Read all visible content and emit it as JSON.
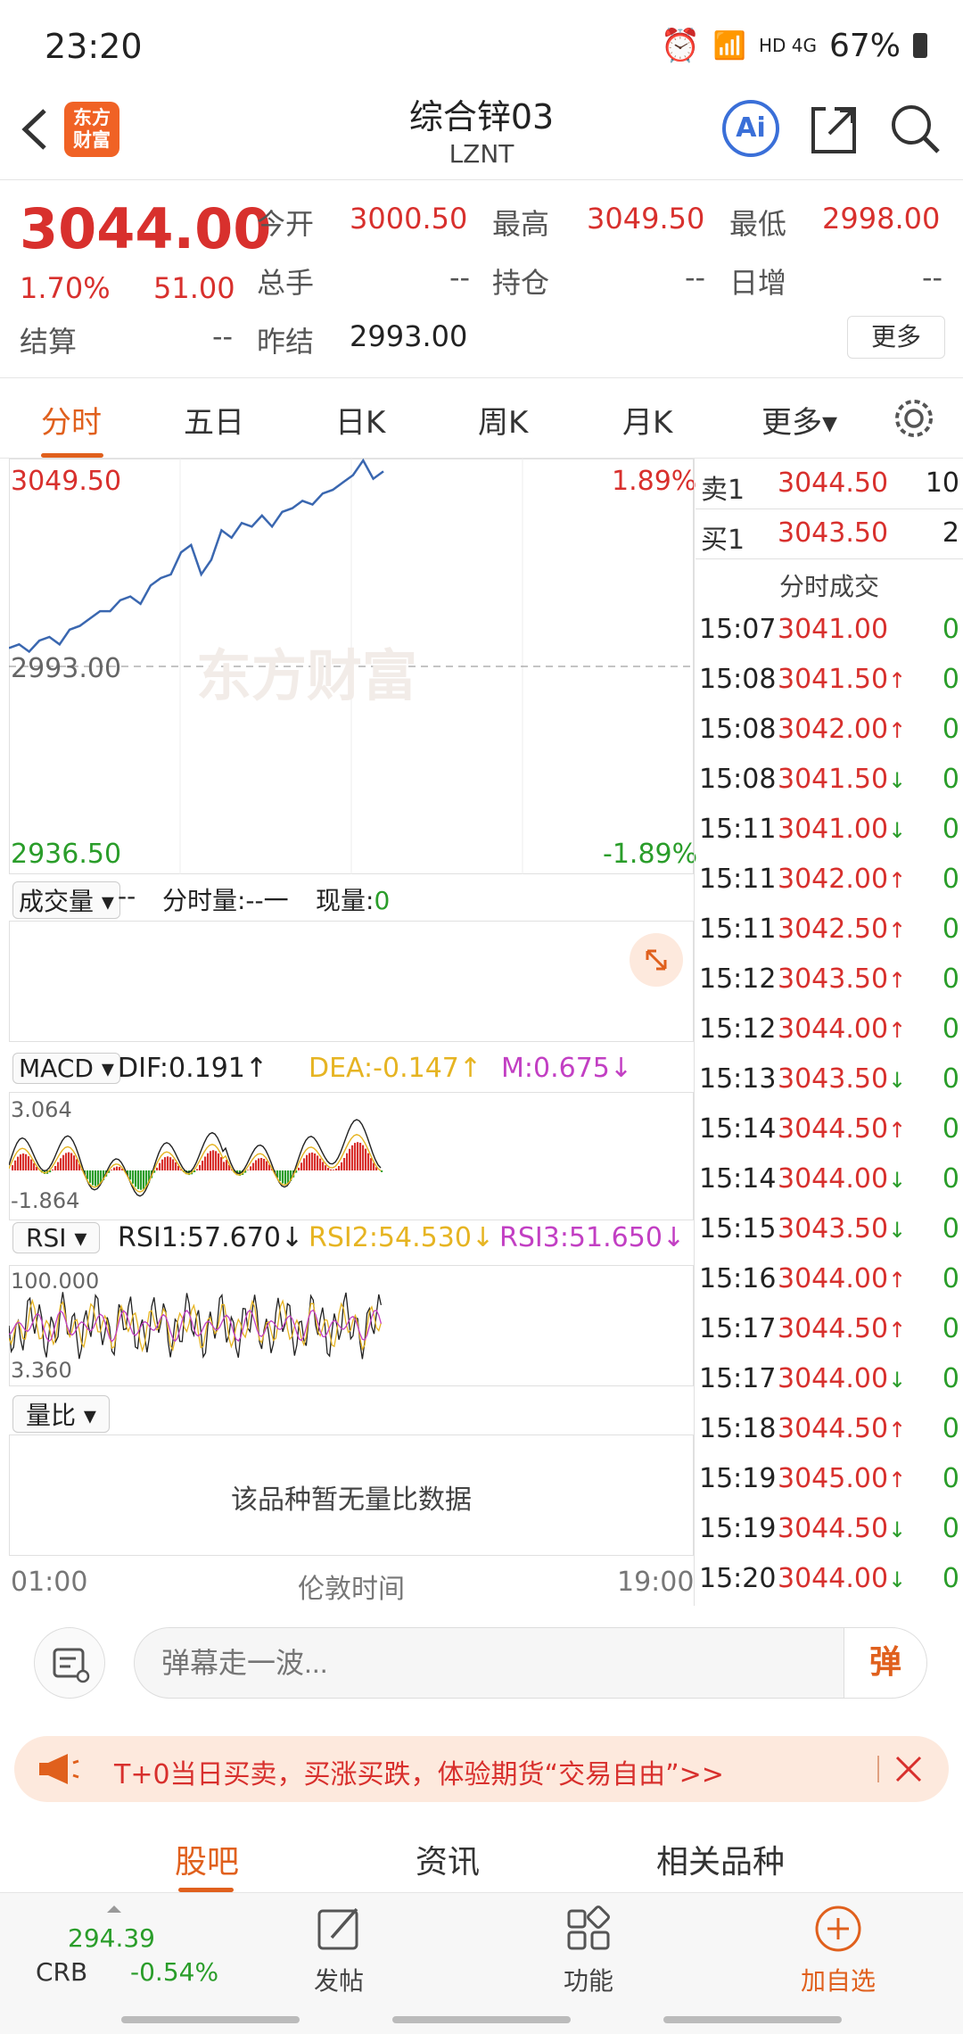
{
  "status_bar": {
    "time": "23:20",
    "network": "HD 4G",
    "battery": "67%"
  },
  "header": {
    "title": "综合锌03",
    "code": "LZNT",
    "logo_text": "东方财富",
    "ai_label": "Ai"
  },
  "quote": {
    "price": "3044.00",
    "change_pct": "1.70%",
    "change": "51.00",
    "open_label": "今开",
    "open": "3000.50",
    "high_label": "最高",
    "high": "3049.50",
    "low_label": "最低",
    "low": "2998.00",
    "volume_label": "总手",
    "volume": "--",
    "oi_label": "持仓",
    "oi": "--",
    "daily_inc_label": "日增",
    "daily_inc": "--",
    "settle_label": "结算",
    "settle": "--",
    "prev_settle_label": "昨结",
    "prev_settle": "2993.00",
    "more_button": "更多"
  },
  "tabs": [
    {
      "label": "分时",
      "active": true
    },
    {
      "label": "五日"
    },
    {
      "label": "日K"
    },
    {
      "label": "周K"
    },
    {
      "label": "月K"
    },
    {
      "label": "更多▾"
    }
  ],
  "chart_data": {
    "type": "line",
    "title": "",
    "price_axis": {
      "top": "3049.50",
      "mid": "2993.00",
      "bottom": "2936.50",
      "top_pct": "1.89%",
      "bottom_pct": "-1.89%"
    },
    "watermark": "东方财富",
    "x_ticks": [
      "01:00",
      "伦敦时间",
      "19:00"
    ],
    "series": [
      {
        "values": [
          2998,
          2999,
          2997,
          3000,
          3001,
          2999,
          3003,
          3004,
          3006,
          3008,
          3008,
          3011,
          3012,
          3010,
          3015,
          3017,
          3018,
          3024,
          3026,
          3018,
          3022,
          3030,
          3028,
          3032,
          3031,
          3034,
          3031,
          3035,
          3036,
          3038,
          3037,
          3040,
          3041,
          3043,
          3045,
          3049,
          3044,
          3046
        ]
      }
    ]
  },
  "volume_panel": {
    "selector": "成交量",
    "value": "--",
    "minute_vol_label": "分时量:--一",
    "cur_vol_label": "现量:",
    "cur_vol": "0"
  },
  "macd_panel": {
    "selector": "MACD",
    "dif": "DIF:0.191↑",
    "dea": "DEA:-0.147↑",
    "m": "M:0.675↓",
    "top": "3.064",
    "bottom": "-1.864",
    "dea_color": "#e6b422",
    "m_color": "#c23fc3"
  },
  "rsi_panel": {
    "selector": "RSI",
    "rsi1": "RSI1:57.670↓",
    "rsi2": "RSI2:54.530↓",
    "rsi3": "RSI3:51.650↓",
    "top": "100.000",
    "bottom": "3.360"
  },
  "ratio_panel": {
    "selector": "量比",
    "empty_text": "该品种暂无量比数据"
  },
  "order_book": {
    "ask_label": "卖1",
    "ask_price": "3044.50",
    "ask_vol": "10",
    "bid_label": "买1",
    "bid_price": "3043.50",
    "bid_vol": "2",
    "trades_title": "分时成交"
  },
  "trades": [
    {
      "time": "15:07",
      "price": "3041.00",
      "dir": "",
      "vol": "0"
    },
    {
      "time": "15:08",
      "price": "3041.50",
      "dir": "↑",
      "vol": "0"
    },
    {
      "time": "15:08",
      "price": "3042.00",
      "dir": "↑",
      "vol": "0"
    },
    {
      "time": "15:08",
      "price": "3041.50",
      "dir": "↓",
      "vol": "0"
    },
    {
      "time": "15:11",
      "price": "3041.00",
      "dir": "↓",
      "vol": "0"
    },
    {
      "time": "15:11",
      "price": "3042.00",
      "dir": "↑",
      "vol": "0"
    },
    {
      "time": "15:11",
      "price": "3042.50",
      "dir": "↑",
      "vol": "0"
    },
    {
      "time": "15:12",
      "price": "3043.50",
      "dir": "↑",
      "vol": "0"
    },
    {
      "time": "15:12",
      "price": "3044.00",
      "dir": "↑",
      "vol": "0"
    },
    {
      "time": "15:13",
      "price": "3043.50",
      "dir": "↓",
      "vol": "0"
    },
    {
      "time": "15:14",
      "price": "3044.50",
      "dir": "↑",
      "vol": "0"
    },
    {
      "time": "15:14",
      "price": "3044.00",
      "dir": "↓",
      "vol": "0"
    },
    {
      "time": "15:15",
      "price": "3043.50",
      "dir": "↓",
      "vol": "0"
    },
    {
      "time": "15:16",
      "price": "3044.00",
      "dir": "↑",
      "vol": "0"
    },
    {
      "time": "15:17",
      "price": "3044.50",
      "dir": "↑",
      "vol": "0"
    },
    {
      "time": "15:17",
      "price": "3044.00",
      "dir": "↓",
      "vol": "0"
    },
    {
      "time": "15:18",
      "price": "3044.50",
      "dir": "↑",
      "vol": "0"
    },
    {
      "time": "15:19",
      "price": "3045.00",
      "dir": "↑",
      "vol": "0"
    },
    {
      "time": "15:19",
      "price": "3044.50",
      "dir": "↓",
      "vol": "0"
    },
    {
      "time": "15:20",
      "price": "3044.00",
      "dir": "↓",
      "vol": "0"
    }
  ],
  "comment": {
    "placeholder": "弹幕走一波...",
    "danmu_label": "弹"
  },
  "banner": {
    "text": "T+0当日买卖，买涨买跌，体验期货“交易自由”>>"
  },
  "bottom_tabs": [
    {
      "label": "股吧",
      "active": true
    },
    {
      "label": "资讯"
    },
    {
      "label": "相关品种"
    }
  ],
  "nav": {
    "index_value": "294.39",
    "index_name": "CRB",
    "index_change": "-0.54%",
    "post": "发帖",
    "func": "功能",
    "add": "加自选"
  },
  "colors": {
    "up": "#d8302d",
    "down": "#2a9d2a",
    "accent": "#e0601d",
    "line": "#3a67b0"
  }
}
